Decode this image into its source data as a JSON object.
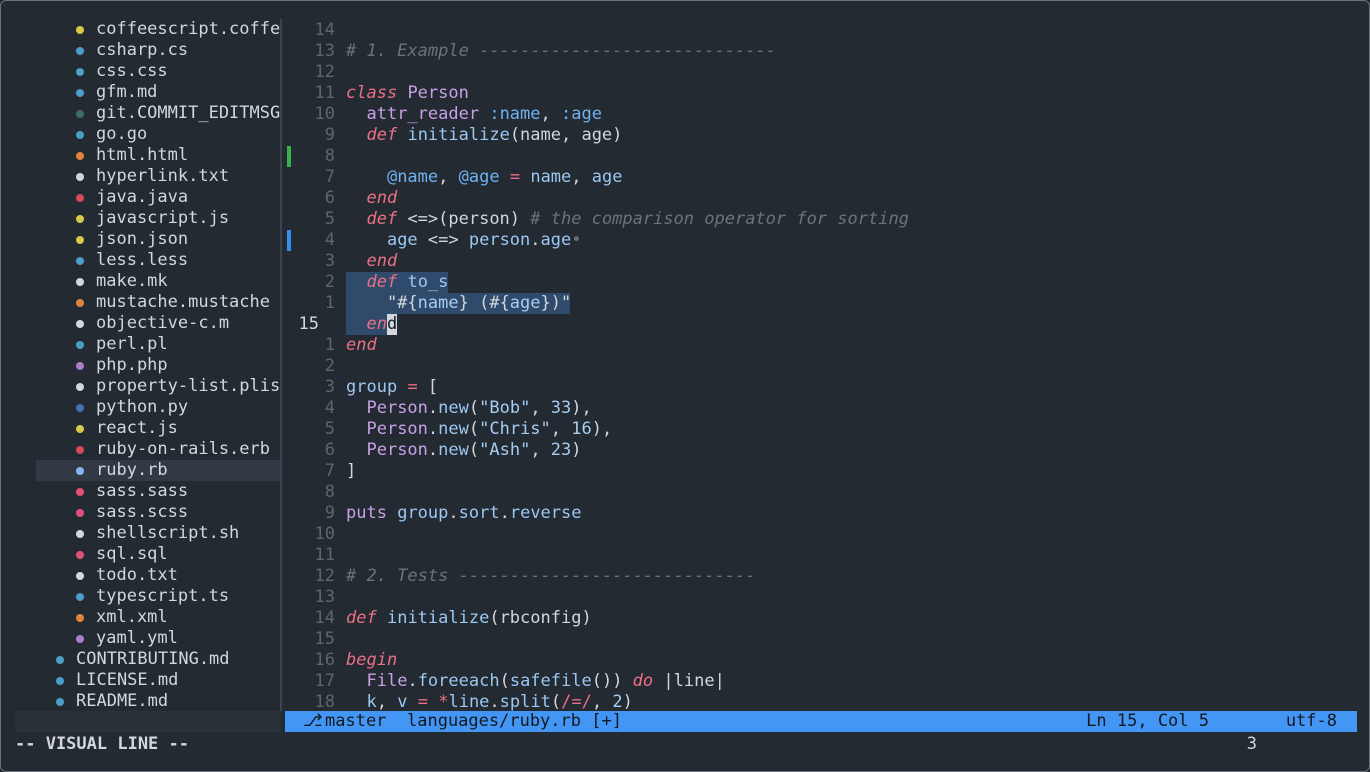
{
  "colors": {
    "yellow": "#d9c94a",
    "blue": "#4a9fc7",
    "darkgreen": "#3d6b63",
    "orange": "#e0843f",
    "white": "#d2d7dc",
    "red": "#d94a59",
    "purple": "#a97ccc",
    "pink": "#e2507a",
    "navy": "#4774b3",
    "lightblue": "#8ab4f8"
  },
  "sidebar": {
    "files": [
      {
        "name": "coffeescript.coffe",
        "color": "yellow",
        "indent": 1
      },
      {
        "name": "csharp.cs",
        "color": "blue",
        "indent": 1
      },
      {
        "name": "css.css",
        "color": "blue",
        "indent": 1
      },
      {
        "name": "gfm.md",
        "color": "blue",
        "indent": 1
      },
      {
        "name": "git.COMMIT_EDITMSG",
        "color": "darkgreen",
        "indent": 1
      },
      {
        "name": "go.go",
        "color": "blue",
        "indent": 1
      },
      {
        "name": "html.html",
        "color": "orange",
        "indent": 1
      },
      {
        "name": "hyperlink.txt",
        "color": "white",
        "indent": 1
      },
      {
        "name": "java.java",
        "color": "red",
        "indent": 1
      },
      {
        "name": "javascript.js",
        "color": "yellow",
        "indent": 1
      },
      {
        "name": "json.json",
        "color": "yellow",
        "indent": 1
      },
      {
        "name": "less.less",
        "color": "blue",
        "indent": 1
      },
      {
        "name": "make.mk",
        "color": "white",
        "indent": 1
      },
      {
        "name": "mustache.mustache",
        "color": "orange",
        "indent": 1
      },
      {
        "name": "objective-c.m",
        "color": "white",
        "indent": 1
      },
      {
        "name": "perl.pl",
        "color": "blue",
        "indent": 1
      },
      {
        "name": "php.php",
        "color": "purple",
        "indent": 1
      },
      {
        "name": "property-list.plis",
        "color": "white",
        "indent": 1
      },
      {
        "name": "python.py",
        "color": "navy",
        "indent": 1
      },
      {
        "name": "react.js",
        "color": "yellow",
        "indent": 1
      },
      {
        "name": "ruby-on-rails.erb",
        "color": "red",
        "indent": 1
      },
      {
        "name": "ruby.rb",
        "color": "lightblue",
        "indent": 1,
        "selected": true
      },
      {
        "name": "sass.sass",
        "color": "pink",
        "indent": 1
      },
      {
        "name": "sass.scss",
        "color": "pink",
        "indent": 1
      },
      {
        "name": "shellscript.sh",
        "color": "white",
        "indent": 1
      },
      {
        "name": "sql.sql",
        "color": "pink",
        "indent": 1
      },
      {
        "name": "todo.txt",
        "color": "white",
        "indent": 1
      },
      {
        "name": "typescript.ts",
        "color": "blue",
        "indent": 1
      },
      {
        "name": "xml.xml",
        "color": "orange",
        "indent": 1
      },
      {
        "name": "yaml.yml",
        "color": "purple",
        "indent": 1
      },
      {
        "name": "CONTRIBUTING.md",
        "color": "blue",
        "indent": 0
      },
      {
        "name": "LICENSE.md",
        "color": "blue",
        "indent": 0
      },
      {
        "name": "README.md",
        "color": "blue",
        "indent": 0
      }
    ]
  },
  "editor": {
    "lines": [
      {
        "num": "14",
        "mark": "",
        "segs": []
      },
      {
        "num": "13",
        "mark": "",
        "segs": [
          [
            "cm",
            "# 1. Example -----------------------------"
          ]
        ]
      },
      {
        "num": "12",
        "mark": "",
        "segs": []
      },
      {
        "num": "11",
        "mark": "",
        "segs": [
          [
            "kw",
            "class"
          ],
          [
            "pl",
            " "
          ],
          [
            "ty",
            "Person"
          ]
        ]
      },
      {
        "num": "10",
        "mark": "",
        "segs": [
          [
            "pl",
            "  "
          ],
          [
            "ty",
            "attr_reader"
          ],
          [
            "pl",
            " "
          ],
          [
            "sy",
            ":name"
          ],
          [
            "pl",
            ", "
          ],
          [
            "sy",
            ":age"
          ]
        ]
      },
      {
        "num": "9",
        "mark": "",
        "segs": [
          [
            "pl",
            "  "
          ],
          [
            "kw",
            "def"
          ],
          [
            "pl",
            " "
          ],
          [
            "fn",
            "initialize"
          ],
          [
            "pl",
            "(name, age)"
          ]
        ]
      },
      {
        "num": "8",
        "mark": "green",
        "segs": []
      },
      {
        "num": "7",
        "mark": "",
        "segs": [
          [
            "pl",
            "    "
          ],
          [
            "iv",
            "@name"
          ],
          [
            "pl",
            ", "
          ],
          [
            "iv",
            "@age"
          ],
          [
            "pl",
            " "
          ],
          [
            "op",
            "="
          ],
          [
            "pl",
            " "
          ],
          [
            "fn",
            "name"
          ],
          [
            "pl",
            ", "
          ],
          [
            "fn",
            "age"
          ]
        ]
      },
      {
        "num": "6",
        "mark": "",
        "segs": [
          [
            "pl",
            "  "
          ],
          [
            "kw",
            "end"
          ]
        ]
      },
      {
        "num": "5",
        "mark": "",
        "segs": [
          [
            "pl",
            "  "
          ],
          [
            "kw",
            "def"
          ],
          [
            "pl",
            " <=>(person) "
          ],
          [
            "cm",
            "# the comparison operator for sorting"
          ]
        ]
      },
      {
        "num": "4",
        "mark": "blue",
        "segs": [
          [
            "pl",
            "    "
          ],
          [
            "fn",
            "age"
          ],
          [
            "pl",
            " <=> "
          ],
          [
            "fn",
            "person"
          ],
          [
            "pl",
            "."
          ],
          [
            "fn",
            "age"
          ],
          [
            "cm",
            "•"
          ]
        ]
      },
      {
        "num": "3",
        "mark": "",
        "segs": [
          [
            "pl",
            "  "
          ],
          [
            "kw",
            "end"
          ]
        ]
      },
      {
        "num": "2",
        "mark": "",
        "segs": [
          [
            "pl",
            "  "
          ],
          [
            "kw",
            "def"
          ],
          [
            "pl",
            " "
          ],
          [
            "fn",
            "to_s"
          ]
        ],
        "sel": [
          0,
          10
        ]
      },
      {
        "num": "1",
        "mark": "",
        "segs": [
          [
            "pl",
            "    \"#{"
          ],
          [
            "st",
            "name"
          ],
          [
            "pl",
            "} (#{"
          ],
          [
            "st",
            "age"
          ],
          [
            "pl",
            "})\""
          ]
        ],
        "sel": [
          0,
          22
        ]
      },
      {
        "num": "15",
        "mark": "",
        "current": true,
        "segs": [
          [
            "pl",
            "  "
          ],
          [
            "kw",
            "en"
          ],
          [
            "pl",
            "d"
          ]
        ],
        "sel": [
          0,
          2
        ]
      },
      {
        "num": "1",
        "mark": "",
        "segs": [
          [
            "kw",
            "end"
          ]
        ]
      },
      {
        "num": "2",
        "mark": "",
        "segs": []
      },
      {
        "num": "3",
        "mark": "",
        "segs": [
          [
            "fn",
            "group"
          ],
          [
            "pl",
            " "
          ],
          [
            "op",
            "="
          ],
          [
            "pl",
            " ["
          ]
        ]
      },
      {
        "num": "4",
        "mark": "",
        "segs": [
          [
            "pl",
            "  "
          ],
          [
            "ty",
            "Person"
          ],
          [
            "pl",
            "."
          ],
          [
            "fn",
            "new"
          ],
          [
            "pl",
            "("
          ],
          [
            "st",
            "\"Bob\""
          ],
          [
            "pl",
            ", "
          ],
          [
            "nu",
            "33"
          ],
          [
            "pl",
            "),"
          ]
        ]
      },
      {
        "num": "5",
        "mark": "",
        "segs": [
          [
            "pl",
            "  "
          ],
          [
            "ty",
            "Person"
          ],
          [
            "pl",
            "."
          ],
          [
            "fn",
            "new"
          ],
          [
            "pl",
            "("
          ],
          [
            "st",
            "\"Chris\""
          ],
          [
            "pl",
            ", "
          ],
          [
            "nu",
            "16"
          ],
          [
            "pl",
            "),"
          ]
        ]
      },
      {
        "num": "6",
        "mark": "",
        "segs": [
          [
            "pl",
            "  "
          ],
          [
            "ty",
            "Person"
          ],
          [
            "pl",
            "."
          ],
          [
            "fn",
            "new"
          ],
          [
            "pl",
            "("
          ],
          [
            "st",
            "\"Ash\""
          ],
          [
            "pl",
            ", "
          ],
          [
            "nu",
            "23"
          ],
          [
            "pl",
            ")"
          ]
        ]
      },
      {
        "num": "7",
        "mark": "",
        "segs": [
          [
            "pl",
            "]"
          ]
        ]
      },
      {
        "num": "8",
        "mark": "",
        "segs": []
      },
      {
        "num": "9",
        "mark": "",
        "segs": [
          [
            "ty",
            "puts"
          ],
          [
            "pl",
            " "
          ],
          [
            "fn",
            "group"
          ],
          [
            "pl",
            "."
          ],
          [
            "fn",
            "sort"
          ],
          [
            "pl",
            "."
          ],
          [
            "fn",
            "reverse"
          ]
        ]
      },
      {
        "num": "10",
        "mark": "",
        "segs": []
      },
      {
        "num": "11",
        "mark": "",
        "segs": []
      },
      {
        "num": "12",
        "mark": "",
        "segs": [
          [
            "cm",
            "# 2. Tests -----------------------------"
          ]
        ]
      },
      {
        "num": "13",
        "mark": "",
        "segs": []
      },
      {
        "num": "14",
        "mark": "",
        "segs": [
          [
            "kw",
            "def"
          ],
          [
            "pl",
            " "
          ],
          [
            "fn",
            "initialize"
          ],
          [
            "pl",
            "(rbconfig)"
          ]
        ]
      },
      {
        "num": "15",
        "mark": "",
        "segs": []
      },
      {
        "num": "16",
        "mark": "",
        "segs": [
          [
            "kw",
            "begin"
          ]
        ]
      },
      {
        "num": "17",
        "mark": "",
        "segs": [
          [
            "pl",
            "  "
          ],
          [
            "ty",
            "File"
          ],
          [
            "pl",
            "."
          ],
          [
            "fn",
            "foreeach"
          ],
          [
            "pl",
            "("
          ],
          [
            "fn",
            "safefile"
          ],
          [
            "pl",
            "()) "
          ],
          [
            "kw",
            "do"
          ],
          [
            "pl",
            " |line|"
          ]
        ]
      },
      {
        "num": "18",
        "mark": "",
        "segs": [
          [
            "pl",
            "  "
          ],
          [
            "fn",
            "k"
          ],
          [
            "pl",
            ", "
          ],
          [
            "fn",
            "v"
          ],
          [
            "pl",
            " "
          ],
          [
            "op",
            "="
          ],
          [
            "pl",
            " "
          ],
          [
            "op",
            "*"
          ],
          [
            "fn",
            "line"
          ],
          [
            "pl",
            "."
          ],
          [
            "fn",
            "split"
          ],
          [
            "pl",
            "("
          ],
          [
            "re",
            "/=/"
          ],
          [
            "pl",
            ", "
          ],
          [
            "nu",
            "2"
          ],
          [
            "pl",
            ")"
          ]
        ]
      }
    ]
  },
  "statusbar": {
    "branch_icon": "⎇",
    "branch": "master",
    "file": "languages/ruby.rb [+]",
    "position": "Ln 15, Col 5",
    "encoding": "utf-8"
  },
  "cmdline": {
    "mode": "-- VISUAL LINE --",
    "count": "3"
  }
}
